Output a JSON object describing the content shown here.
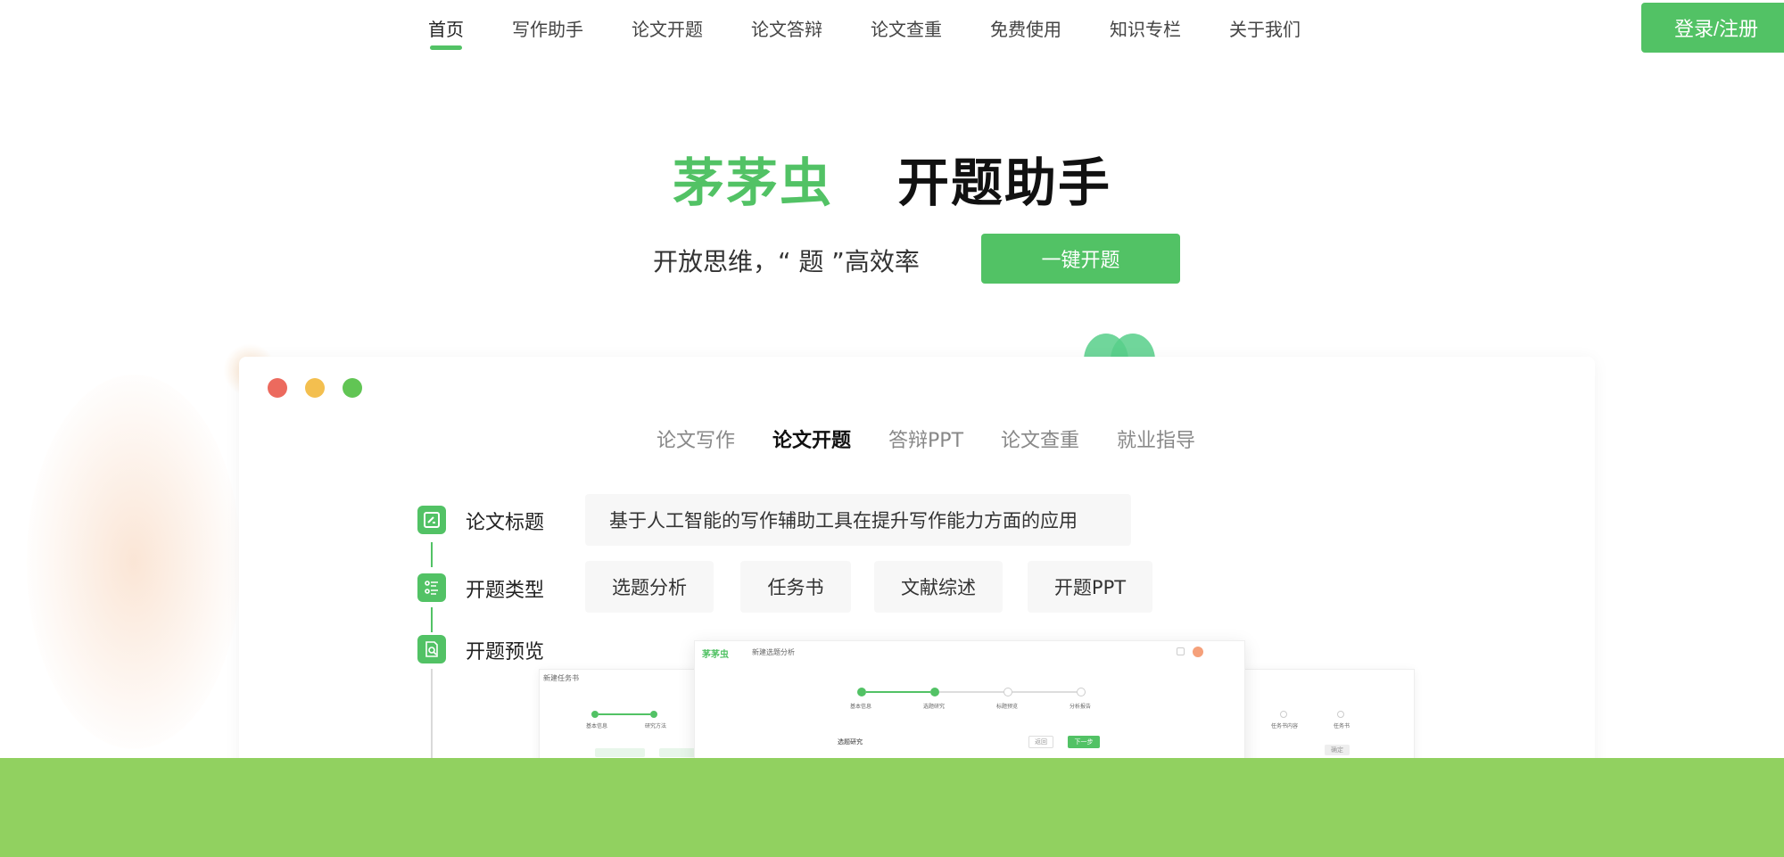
{
  "nav": {
    "links": [
      "首页",
      "写作助手",
      "论文开题",
      "论文答辩",
      "论文查重",
      "免费使用",
      "知识专栏",
      "关于我们"
    ],
    "login_label": "登录/注册"
  },
  "hero": {
    "brand": "茅茅虫",
    "title": "开题助手",
    "tagline": "开放思维，“ 题 ”高效率",
    "cta_label": "一键开题"
  },
  "card": {
    "tabs": [
      "论文写作",
      "论文开题",
      "答辩PPT",
      "论文查重",
      "就业指导"
    ],
    "active_tab": 1,
    "steps": {
      "title_label": "论文标题",
      "type_label": "开题类型",
      "preview_label": "开题预览"
    },
    "paper_title": "基于人工智能的写作辅助工具在提升写作能力方面的应用",
    "types": [
      "选题分析",
      "任务书",
      "文献综述",
      "开题PPT"
    ],
    "preview": {
      "front_brand": "茅茅虫",
      "front_title": "新建选题分析",
      "back_title": "新建任务书",
      "front_steps": [
        "基本信息",
        "选题研究",
        "标题预览",
        "分析报告"
      ],
      "back_steps": [
        "基本信息",
        "研究方法"
      ],
      "back_steps_right": [
        "任务书内容",
        "任务书"
      ],
      "form_label": "选题研究",
      "prev_label": "返回",
      "next_label": "下一步",
      "back_btn": "确定"
    }
  },
  "colors": {
    "accent": "#52c265",
    "bottom_band": "#91d160"
  }
}
